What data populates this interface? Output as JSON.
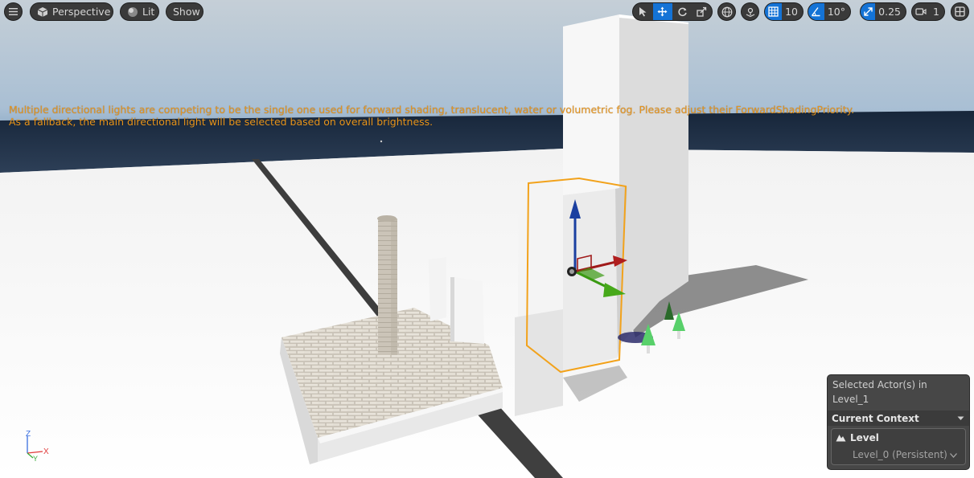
{
  "toolbar": {
    "viewport_type_label": "Perspective",
    "view_mode_label": "Lit",
    "show_label": "Show",
    "grid_snap_value": "10",
    "rotation_snap_value": "10°",
    "scale_snap_value": "0.25",
    "camera_speed_value": "1"
  },
  "warning": {
    "line1": "Multiple directional lights are competing to be the single one used for forward shading, translucent, water or volumetric fog. Please adjust their ForwardShadingPriority.",
    "line2": "As a fallback, the main directional light will be selected based on overall brightness."
  },
  "axis_gizmo": {
    "z": "Z",
    "x": "X",
    "y": "Y"
  },
  "selection_panel": {
    "title": "Selected Actor(s) in Level_1",
    "context_label": "Current Context",
    "level_label": "Level",
    "level_value": "Level_0 (Persistent)"
  },
  "colors": {
    "accent": "#1473d6",
    "warning_text": "#e8951c",
    "selection_outline": "#f2a21b",
    "toolbar_bg": "#3a3a3a"
  }
}
